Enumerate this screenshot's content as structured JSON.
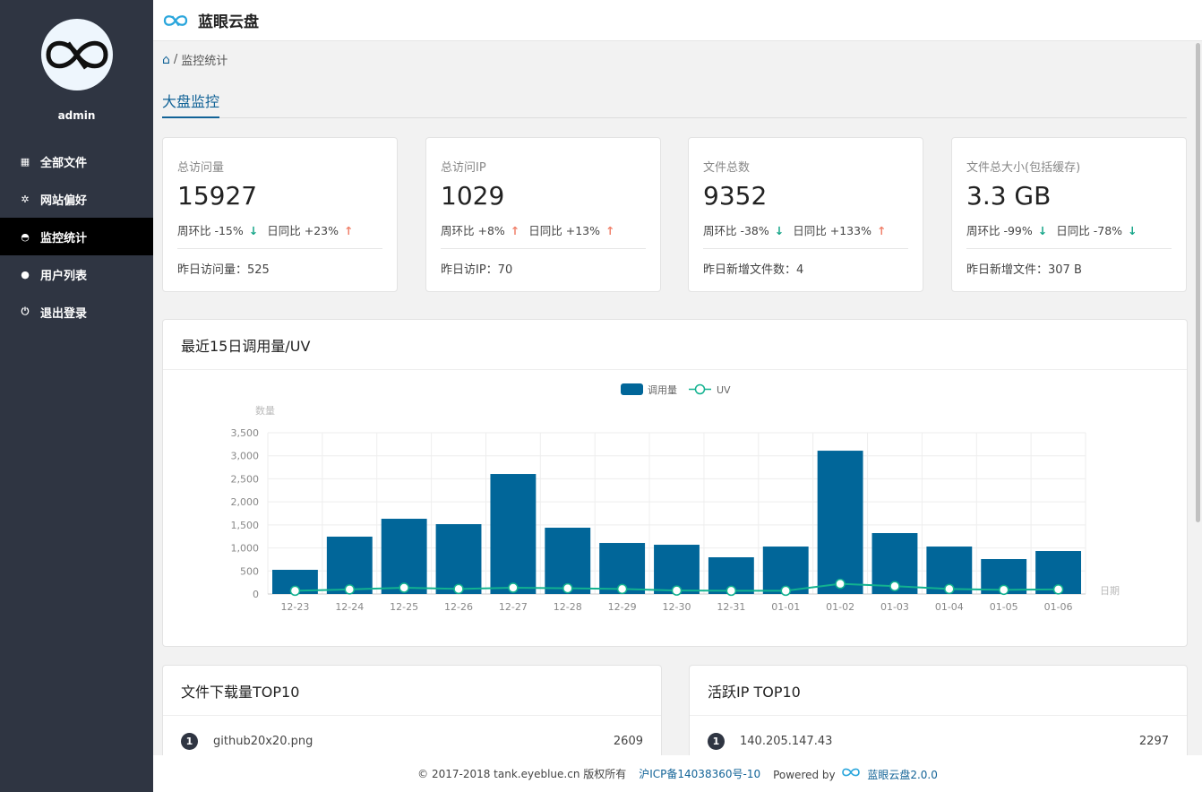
{
  "app": {
    "title": "蓝眼云盘",
    "brand_color": "#126397"
  },
  "sidebar": {
    "username": "admin",
    "items": [
      {
        "label": "全部文件",
        "icon": "grid-icon"
      },
      {
        "label": "网站偏好",
        "icon": "gear-icon"
      },
      {
        "label": "监控统计",
        "icon": "dashboard-icon",
        "active": true
      },
      {
        "label": "用户列表",
        "icon": "user-icon"
      },
      {
        "label": "退出登录",
        "icon": "power-icon"
      }
    ]
  },
  "breadcrumb": {
    "separator": "/",
    "current": "监控统计"
  },
  "tabs": [
    {
      "label": "大盘监控"
    }
  ],
  "cards": [
    {
      "label": "总访问量",
      "value": "15927",
      "week": "周环比 -15%",
      "week_dir": "down",
      "day": "日同比 +23%",
      "day_dir": "up",
      "footer": "昨日访问量：525"
    },
    {
      "label": "总访问IP",
      "value": "1029",
      "week": "周环比 +8%",
      "week_dir": "up",
      "day": "日同比 +13%",
      "day_dir": "up",
      "footer": "昨日访IP：70"
    },
    {
      "label": "文件总数",
      "value": "9352",
      "week": "周环比 -38%",
      "week_dir": "down",
      "day": "日同比 +133%",
      "day_dir": "up",
      "footer": "昨日新增文件数：4"
    },
    {
      "label": "文件总大小(包括缓存)",
      "value": "3.3 GB",
      "week": "周环比 -99%",
      "week_dir": "down",
      "day": "日同比 -78%",
      "day_dir": "down",
      "footer": "昨日新增文件：307 B"
    }
  ],
  "chart_panel": {
    "title": "最近15日调用量/UV"
  },
  "chart_data": {
    "type": "bar",
    "categories": [
      "12-23",
      "12-24",
      "12-25",
      "12-26",
      "12-27",
      "12-28",
      "12-29",
      "12-30",
      "12-31",
      "01-01",
      "01-02",
      "01-03",
      "01-04",
      "01-05",
      "01-06"
    ],
    "series": [
      {
        "name": "调用量",
        "type": "bar",
        "color": "#016699",
        "values": [
          525,
          1245,
          1633,
          1516,
          2605,
          1439,
          1108,
          1069,
          797,
          1030,
          3110,
          1322,
          1030,
          758,
          933
        ]
      },
      {
        "name": "UV",
        "type": "line",
        "color": "#12b290",
        "values": [
          70,
          100,
          135,
          110,
          135,
          125,
          110,
          75,
          70,
          70,
          220,
          170,
          110,
          90,
          100
        ]
      }
    ],
    "ylabel": "数量",
    "xlabel": "日期",
    "ylim": [
      0,
      3500
    ],
    "yticks": [
      "0",
      "500",
      "1,000",
      "1,500",
      "2,000",
      "2,500",
      "3,000",
      "3,500"
    ],
    "grid": true,
    "legend": "top-center"
  },
  "downloads": {
    "title": "文件下载量TOP10",
    "items": [
      {
        "rank": "1",
        "name": "github20x20.png",
        "count": "2609"
      }
    ]
  },
  "active_ip": {
    "title": "活跃IP TOP10",
    "items": [
      {
        "rank": "1",
        "name": "140.205.147.43",
        "count": "2297"
      }
    ]
  },
  "footer": {
    "copyright": "© 2017-2018 tank.eyeblue.cn 版权所有",
    "icp": "沪ICP备14038360号-10",
    "powered": "Powered by",
    "product": "蓝眼云盘2.0.0"
  }
}
